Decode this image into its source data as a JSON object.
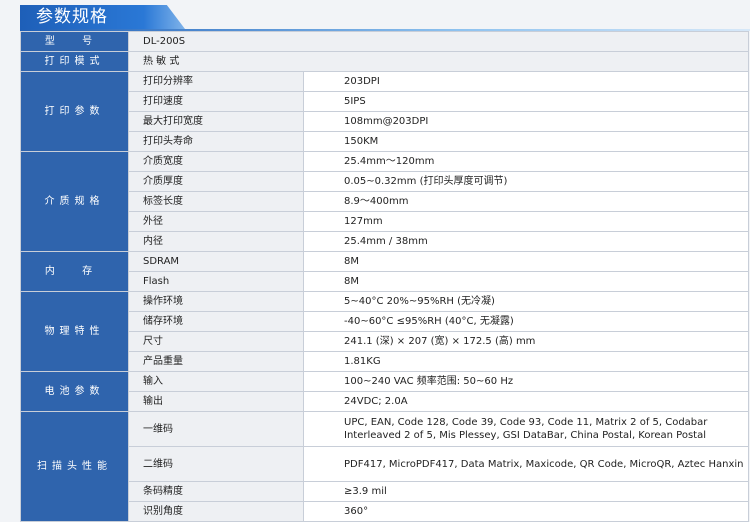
{
  "header": {
    "title": "参数规格"
  },
  "rows": {
    "model": {
      "cat": "型 号",
      "value": "DL-200S"
    },
    "print_mode": {
      "cat": "打印模式",
      "value": "热 敏 式"
    },
    "print_params": {
      "cat": "打印参数",
      "items": [
        {
          "label": "打印分辨率",
          "value": "203DPI"
        },
        {
          "label": "打印速度",
          "value": "5IPS"
        },
        {
          "label": "最大打印宽度",
          "value": "108mm@203DPI"
        },
        {
          "label": "打印头寿命",
          "value": "150KM"
        }
      ]
    },
    "media": {
      "cat": "介质规格",
      "items": [
        {
          "label": "介质宽度",
          "value": "25.4mm～120mm"
        },
        {
          "label": "介质厚度",
          "value": "0.05~0.32mm (打印头厚度可调节)"
        },
        {
          "label": "标签长度",
          "value": "8.9～400mm"
        },
        {
          "label": "外径",
          "value": "127mm"
        },
        {
          "label": "内径",
          "value": "25.4mm / 38mm"
        }
      ]
    },
    "memory": {
      "cat": "内 存",
      "items": [
        {
          "label": "SDRAM",
          "value": "8M"
        },
        {
          "label": "Flash",
          "value": "8M"
        }
      ]
    },
    "physical": {
      "cat": "物理特性",
      "items": [
        {
          "label": "操作环境",
          "value": "5~40°C 20%~95%RH (无冷凝)"
        },
        {
          "label": "储存环境",
          "value": "-40~60°C ≤95%RH (40°C, 无凝露)"
        },
        {
          "label": "尺寸",
          "value": "241.1 (深) × 207 (宽) × 172.5 (高) mm"
        },
        {
          "label": "产品重量",
          "value": "1.81KG"
        }
      ]
    },
    "battery": {
      "cat": "电池参数",
      "items": [
        {
          "label": "输入",
          "value": "100~240 VAC  频率范围: 50~60 Hz"
        },
        {
          "label": "输出",
          "value": "24VDC; 2.0A"
        }
      ]
    },
    "scan_head": {
      "cat": "扫描头性能",
      "items": [
        {
          "label": "一维码",
          "value": "UPC, EAN, Code 128, Code 39, Code 93, Code 11, Matrix 2 of 5, Codabar Interleaved 2 of 5, Mis Plessey, GSI DataBar, China Postal, Korean Postal"
        },
        {
          "label": "二维码",
          "value": "PDF417, MicroPDF417, Data Matrix, Maxicode, QR Code, MicroQR, Aztec Hanxin"
        },
        {
          "label": "条码精度",
          "value": "≥3.9 mil"
        },
        {
          "label": "识别角度",
          "value": "360°"
        }
      ]
    }
  }
}
